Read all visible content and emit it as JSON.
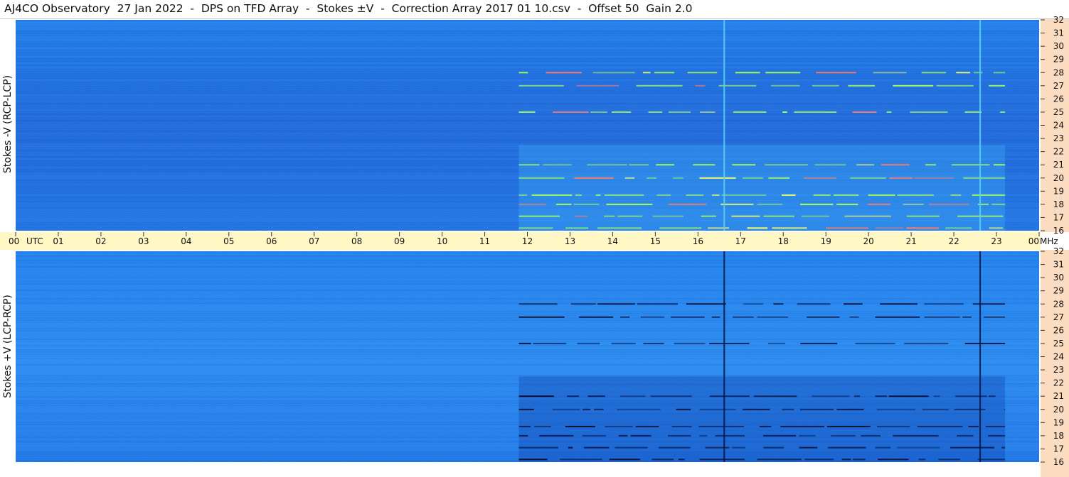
{
  "header": {
    "title": "AJ4CO Observatory  27 Jan 2022  -  DPS on TFD Array  -  Stokes ±V  -  Correction Array 2017 01 10.csv  -  Offset 50  Gain 2.0"
  },
  "panels": {
    "top_label": "Stokes -V (RCP-LCP)",
    "bottom_label": "Stokes +V (LCP-RCP)"
  },
  "colors": {
    "background_blue": "#1f7ae8",
    "time_axis_band": "#fff8c4",
    "freq_axis_band": "#fbdcc0",
    "emission_bright": "#a8ff5a",
    "emission_dark": "#081a55"
  },
  "chart_data": [
    {
      "type": "heatmap",
      "panel": "Stokes -V (RCP-LCP)",
      "x_ticks": [
        "00",
        "01",
        "02",
        "03",
        "04",
        "05",
        "06",
        "07",
        "08",
        "09",
        "10",
        "11",
        "12",
        "13",
        "14",
        "15",
        "16",
        "17",
        "18",
        "19",
        "20",
        "21",
        "22",
        "23",
        "00"
      ],
      "x_unit_label": "UTC",
      "y_ticks": [
        "32",
        "31",
        "30",
        "29",
        "28",
        "27",
        "26",
        "25",
        "24",
        "23",
        "22",
        "21",
        "20",
        "19",
        "18",
        "17",
        "16"
      ],
      "y_unit_label": "MHz",
      "xlim_utc_hours": [
        0,
        24
      ],
      "ylim_mhz": [
        16,
        32
      ],
      "activity": {
        "start_utc_hours": 11.8,
        "end_utc_hours": 23.2,
        "bands_mhz": [
          16.2,
          17.1,
          18.0,
          18.7,
          20.0,
          21.0,
          25.0,
          27.0,
          28.0
        ],
        "appearance": "bright"
      },
      "interference_lines_utc_hours": [
        16.6,
        22.6
      ]
    },
    {
      "type": "heatmap",
      "panel": "Stokes +V (LCP-RCP)",
      "x_ticks": [
        "00",
        "01",
        "02",
        "03",
        "04",
        "05",
        "06",
        "07",
        "08",
        "09",
        "10",
        "11",
        "12",
        "13",
        "14",
        "15",
        "16",
        "17",
        "18",
        "19",
        "20",
        "21",
        "22",
        "23",
        "00"
      ],
      "x_unit_label": "UTC",
      "y_ticks": [
        "32",
        "31",
        "30",
        "29",
        "28",
        "27",
        "26",
        "25",
        "24",
        "23",
        "22",
        "21",
        "20",
        "19",
        "18",
        "17",
        "16"
      ],
      "y_unit_label": "MHz",
      "xlim_utc_hours": [
        0,
        24
      ],
      "ylim_mhz": [
        16,
        32
      ],
      "activity": {
        "start_utc_hours": 11.8,
        "end_utc_hours": 23.2,
        "bands_mhz": [
          16.2,
          17.1,
          18.0,
          18.7,
          20.0,
          21.0,
          25.0,
          27.0,
          28.0
        ],
        "appearance": "dark"
      },
      "interference_lines_utc_hours": [
        16.6,
        22.6
      ]
    }
  ]
}
